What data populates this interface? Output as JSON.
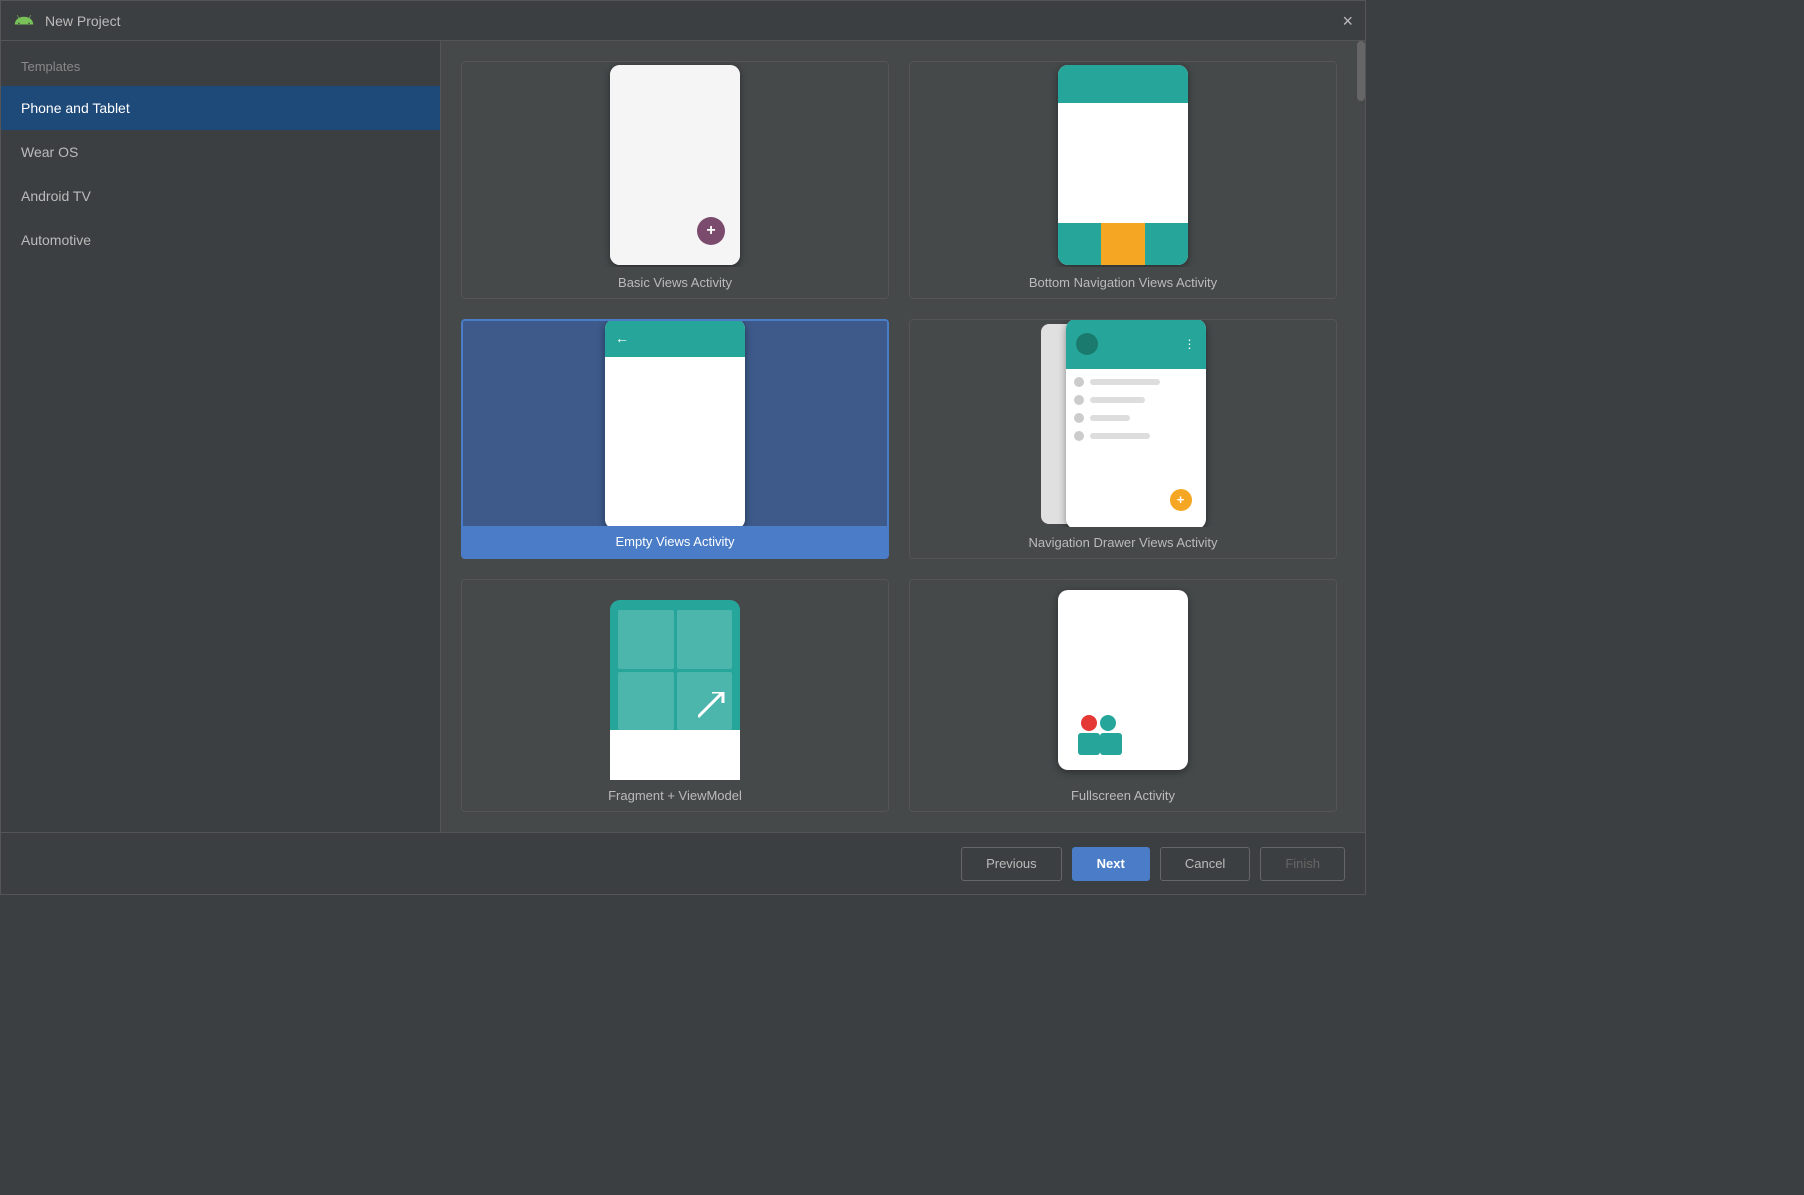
{
  "titleBar": {
    "title": "New Project",
    "closeLabel": "×",
    "androidIconAlt": "Android"
  },
  "sidebar": {
    "header": "Templates",
    "items": [
      {
        "id": "phone-tablet",
        "label": "Phone and Tablet",
        "active": true
      },
      {
        "id": "wear-os",
        "label": "Wear OS",
        "active": false
      },
      {
        "id": "android-tv",
        "label": "Android TV",
        "active": false
      },
      {
        "id": "automotive",
        "label": "Automotive",
        "active": false
      }
    ]
  },
  "templates": [
    {
      "id": "basic-views",
      "label": "Basic Views Activity",
      "selected": false
    },
    {
      "id": "bottom-nav",
      "label": "Bottom Navigation Views Activity",
      "selected": false
    },
    {
      "id": "empty-views",
      "label": "Empty Views Activity",
      "selected": true
    },
    {
      "id": "nav-drawer",
      "label": "Navigation Drawer Views Activity",
      "selected": false
    },
    {
      "id": "template5",
      "label": "Fragment + ViewModel",
      "selected": false
    },
    {
      "id": "template6",
      "label": "Fullscreen Activity",
      "selected": false
    }
  ],
  "footer": {
    "previousLabel": "Previous",
    "nextLabel": "Next",
    "cancelLabel": "Cancel",
    "finishLabel": "Finish"
  }
}
